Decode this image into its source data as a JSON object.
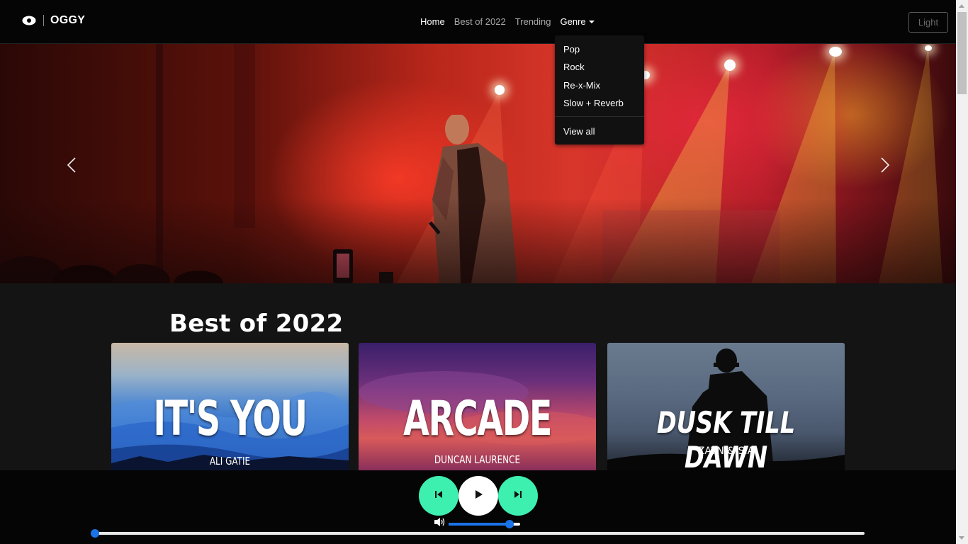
{
  "navbar": {
    "brand": "OGGY",
    "links": [
      {
        "label": "Home",
        "active": true
      },
      {
        "label": "Best of 2022",
        "active": false
      },
      {
        "label": "Trending",
        "active": false
      },
      {
        "label": "Genre",
        "active": false,
        "dropdown": true
      }
    ],
    "theme_button": "Light"
  },
  "genre_dropdown": {
    "items": [
      "Pop",
      "Rock",
      "Re-x-Mix",
      "Slow + Reverb"
    ],
    "view_all": "View all"
  },
  "hero": {
    "prev_icon": "chevron-left-icon",
    "next_icon": "chevron-right-icon"
  },
  "section": {
    "title": "Best of 2022",
    "cards": [
      {
        "title": "IT'S YOU",
        "artist": "ALI GATIE"
      },
      {
        "title": "ARCADE",
        "artist": "DUNCAN LAURENCE"
      },
      {
        "title": "DUSK TILL DAWN",
        "artist": "ZAYN & SIA"
      }
    ]
  },
  "player": {
    "prev_icon": "skip-previous-icon",
    "play_icon": "play-icon",
    "next_icon": "skip-next-icon",
    "volume_icon": "volume-icon",
    "volume_level": 0.85,
    "progress": 0.0,
    "accent_color": "#3df0b0",
    "slider_color": "#1a73e8"
  }
}
